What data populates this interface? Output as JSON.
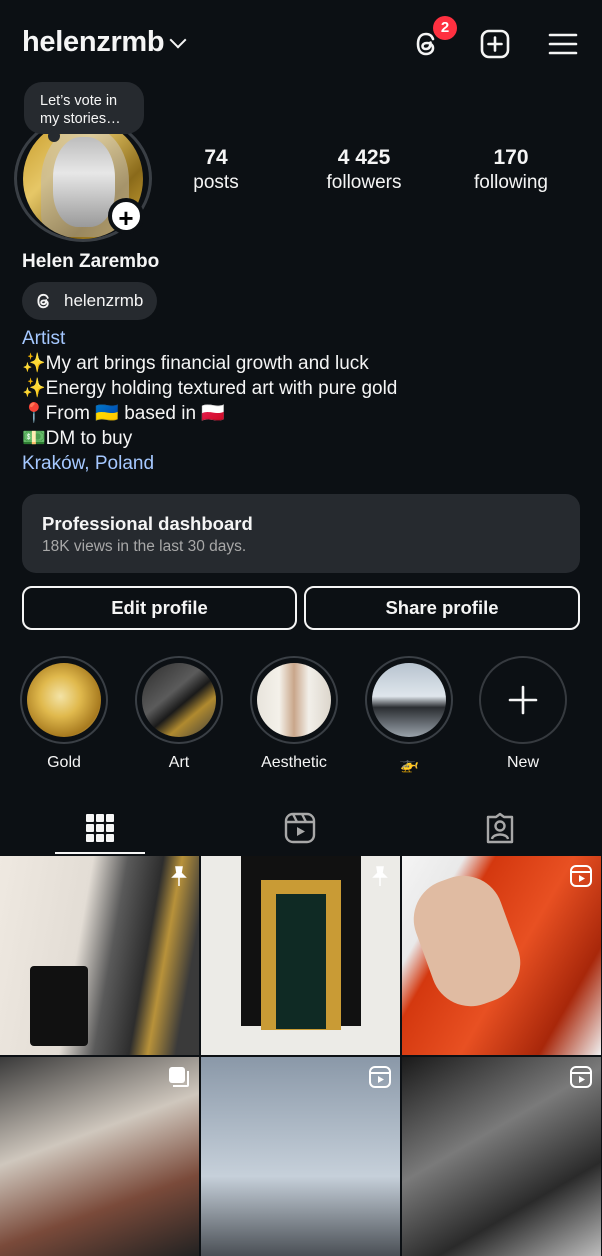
{
  "header": {
    "username": "helenzrmb",
    "threads_badge_count": "2",
    "icons": [
      "threads-icon",
      "create-post-icon",
      "menu-icon"
    ]
  },
  "profile": {
    "note": "Let’s vote in my stories…",
    "stats": [
      {
        "value": "74",
        "label": "posts"
      },
      {
        "value": "4 425",
        "label": "followers"
      },
      {
        "value": "170",
        "label": "following"
      }
    ],
    "full_name": "Helen Zarembo",
    "threads_handle": "helenzrmb",
    "category": "Artist",
    "bio_lines": [
      "✨My art brings financial growth and luck",
      "✨Energy holding textured art with pure gold",
      "📍From 🇺🇦 based in 🇵🇱",
      "💵DM to buy"
    ],
    "location": "Kraków, Poland"
  },
  "dashboard": {
    "title": "Professional dashboard",
    "subtitle": "18K views in the last 30 days."
  },
  "buttons": {
    "edit": "Edit profile",
    "share": "Share profile"
  },
  "highlights": [
    {
      "label": "Gold"
    },
    {
      "label": "Art"
    },
    {
      "label": "Aesthetic"
    },
    {
      "label": "🚁"
    },
    {
      "label": "New"
    }
  ],
  "tabs": [
    "grid",
    "reels",
    "tagged"
  ],
  "colors": {
    "background": "#0c1014",
    "surface": "#262a2f",
    "link": "#a5c8ff",
    "badge": "#ff3040"
  }
}
